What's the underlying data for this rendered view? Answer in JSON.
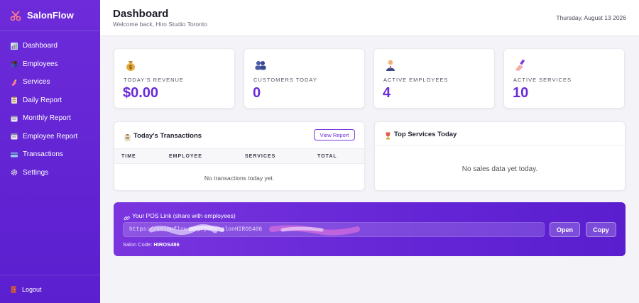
{
  "app": {
    "name": "SalonFlow"
  },
  "sidebar": {
    "items": [
      {
        "label": "Dashboard",
        "icon": "bar-chart-icon",
        "color": "#8fb4ff"
      },
      {
        "label": "Employees",
        "icon": "people-icon",
        "color": "#a07a5a"
      },
      {
        "label": "Services",
        "icon": "nail-polish-icon",
        "color": "#ff8fb5"
      },
      {
        "label": "Daily Report",
        "icon": "clipboard-icon",
        "color": "#e6d7b6"
      },
      {
        "label": "Monthly Report",
        "icon": "calendar-icon",
        "color": "#d8d8f0"
      },
      {
        "label": "Employee Report",
        "icon": "calendar-icon",
        "color": "#d8d8f0"
      },
      {
        "label": "Transactions",
        "icon": "credit-card-icon",
        "color": "#7fb0ff"
      },
      {
        "label": "Settings",
        "icon": "gear-icon",
        "color": "#c8c8d8"
      }
    ],
    "logout_label": "Logout"
  },
  "header": {
    "title": "Dashboard",
    "subtitle": "Welcome back, Hiro Studio Toronto",
    "date": "Thursday, August 13 2026"
  },
  "stats": [
    {
      "label": "Today's Revenue",
      "value": "$0.00",
      "icon": "money-bag-icon"
    },
    {
      "label": "Customers Today",
      "value": "0",
      "icon": "people-icon"
    },
    {
      "label": "Active Employees",
      "value": "4",
      "icon": "person-icon"
    },
    {
      "label": "Active Services",
      "value": "10",
      "icon": "nail-polish-icon"
    }
  ],
  "transactions": {
    "title": "Today's Transactions",
    "view_button": "View Report",
    "columns": [
      "TIME",
      "EMPLOYEE",
      "SERVICES",
      "TOTAL"
    ],
    "empty_text": "No transactions today yet."
  },
  "top_services": {
    "title": "Top Services Today",
    "empty_text": "No sales data yet today."
  },
  "pos": {
    "label": "Your POS Link (share with employees)",
    "link_value": "https://salonflow.app/pos/salonHIROS486",
    "open_label": "Open",
    "copy_label": "Copy",
    "code_prefix": "Salon Code:",
    "code_value": "HIROS486"
  },
  "colors": {
    "accent": "#6a2bd8",
    "sidebar": "#5b1fcf"
  }
}
